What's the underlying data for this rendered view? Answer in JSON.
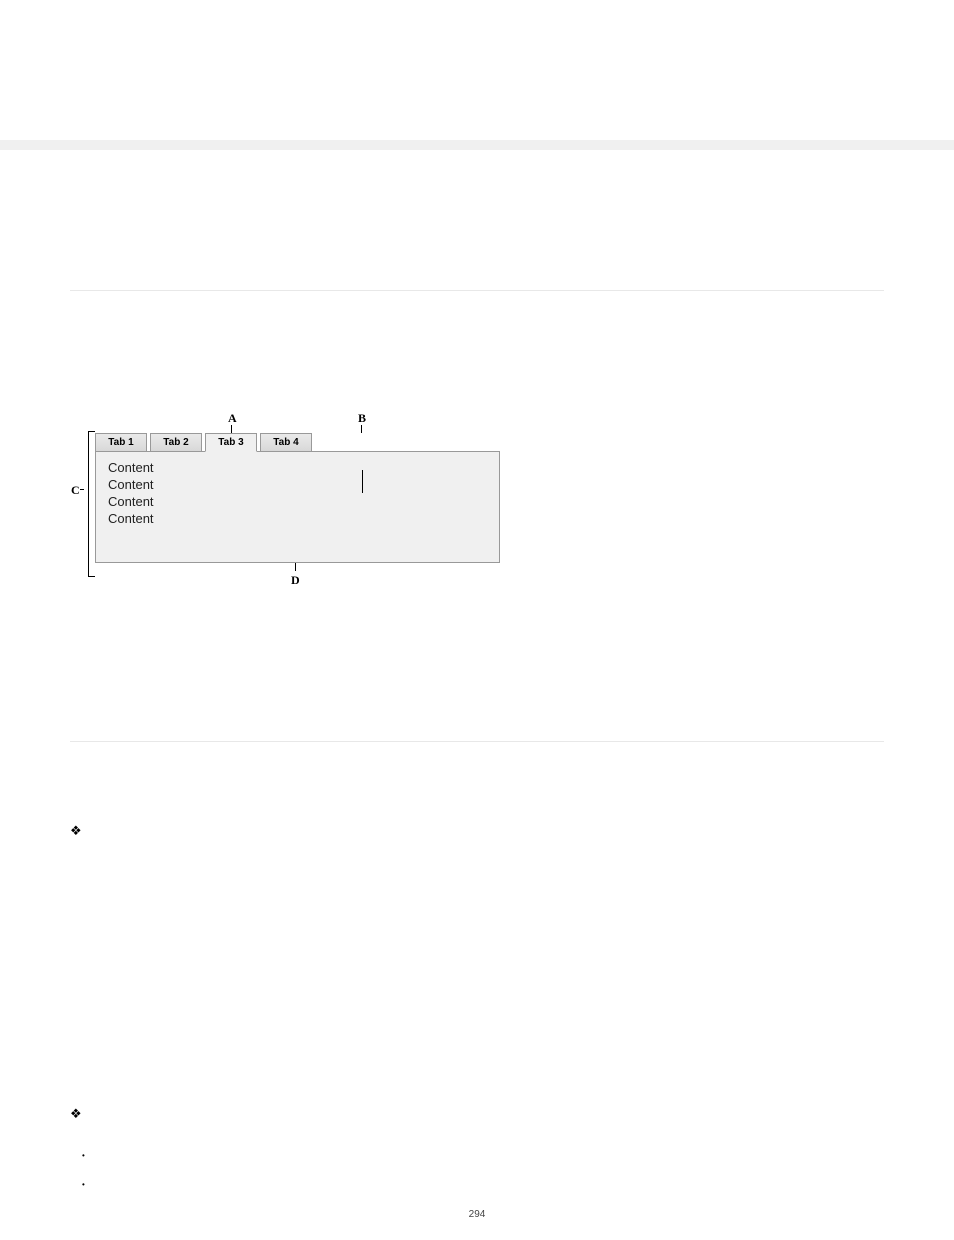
{
  "tabs": {
    "row": [
      {
        "label": "Tab 1",
        "active": false
      },
      {
        "label": "Tab 2",
        "active": false
      },
      {
        "label": "Tab 3",
        "active": true
      },
      {
        "label": "Tab 4",
        "active": false
      }
    ],
    "content": [
      "Content",
      "Content",
      "Content",
      "Content"
    ]
  },
  "markers": {
    "A": "A",
    "B": "B",
    "C": "C",
    "D": "D"
  },
  "bullets": {
    "diamond1": "❖",
    "diamond2": "❖",
    "dot": "•"
  },
  "page_number": "294"
}
